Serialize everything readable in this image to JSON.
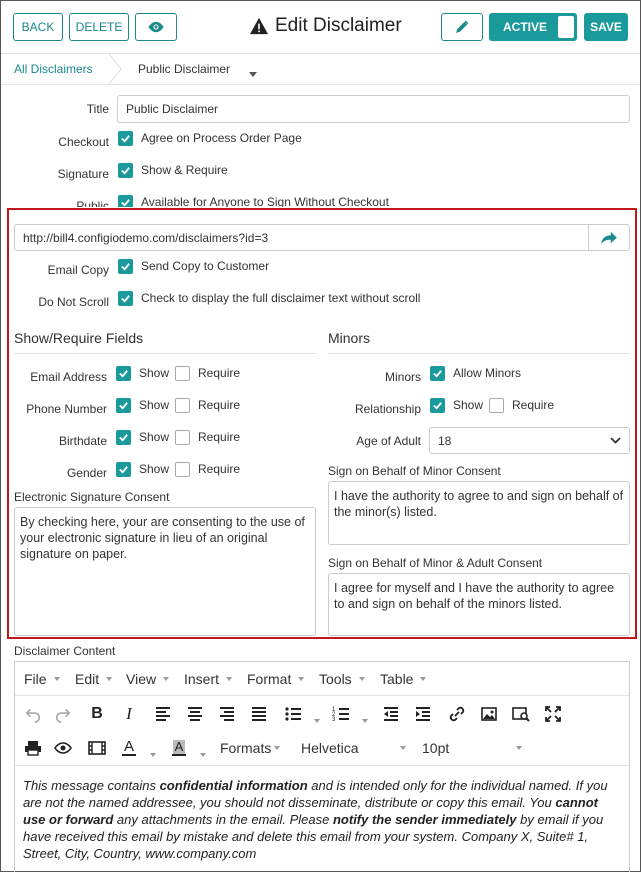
{
  "header": {
    "back_label": "BACK",
    "delete_label": "DELETE",
    "title": "Edit Disclaimer",
    "active_label": "ACTIVE",
    "save_label": "SAVE"
  },
  "breadcrumb": {
    "all": "All Disclaimers",
    "current": "Public Disclaimer"
  },
  "form": {
    "title_label": "Title",
    "title_value": "Public Disclaimer",
    "checkout_label": "Checkout",
    "checkout_text": "Agree on Process Order Page",
    "signature_label": "Signature",
    "signature_text": "Show & Require",
    "public_label": "Public",
    "public_text": "Available for Anyone to Sign Without Checkout",
    "url": "http://bill4.configiodemo.com/disclaimers?id=3",
    "email_copy_label": "Email Copy",
    "email_copy_text": "Send Copy to Customer",
    "no_scroll_label": "Do Not Scroll",
    "no_scroll_text": "Check to display the full disclaimer text without scroll"
  },
  "fields": {
    "section_title": "Show/Require Fields",
    "show": "Show",
    "require": "Require",
    "rows": [
      {
        "label": "Email Address"
      },
      {
        "label": "Phone Number"
      },
      {
        "label": "Birthdate"
      },
      {
        "label": "Gender"
      }
    ],
    "esig_label": "Electronic Signature Consent",
    "esig_text": "By checking here, your are consenting to the use of your electronic signature in lieu of an original signature on paper."
  },
  "minors": {
    "section_title": "Minors",
    "minors_label": "Minors",
    "allow_text": "Allow Minors",
    "relationship_label": "Relationship",
    "show": "Show",
    "require": "Require",
    "age_label": "Age of Adult",
    "age_value": "18",
    "behalf_label": "Sign on Behalf of Minor Consent",
    "behalf_text": "I have the authority to agree to and sign on behalf of the minor(s) listed.",
    "adult_label": "Sign on Behalf of Minor & Adult Consent",
    "adult_text": "I agree for myself and I have the authority to agree to and sign on behalf of the minors listed."
  },
  "editor": {
    "label": "Disclaimer Content",
    "menus": [
      "File",
      "Edit",
      "View",
      "Insert",
      "Format",
      "Tools",
      "Table"
    ],
    "formats_label": "Formats",
    "font_value": "Helvetica",
    "size_value": "10pt",
    "content": {
      "p1": "This message contains ",
      "b1": "confidential information",
      "p2": " and is intended only for the individual named. If you are not the named addressee, you should not disseminate, distribute or copy this email. You ",
      "b2": "cannot use or forward",
      "p3": " any attachments in the email. Please ",
      "b3": "notify the sender immediately",
      "p4": " by email if you have received this email by mistake and delete this email from your system. Company X, Suite# 1, Street, City, Country, www.company.com"
    }
  },
  "colors": {
    "accent": "#1a9a9a",
    "highlight_border": "#c0161c"
  }
}
